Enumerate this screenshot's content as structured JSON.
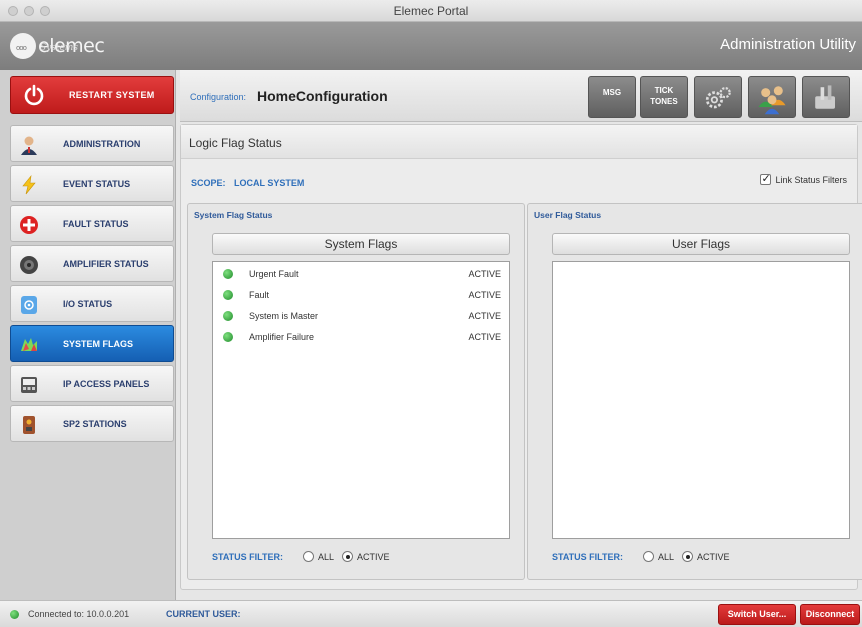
{
  "window": {
    "title": "Elemec Portal"
  },
  "brand": {
    "logo_text": "elemec",
    "logo_sub": "Systems",
    "app_title": "Administration Utility"
  },
  "sidebar": {
    "restart_label": "RESTART SYSTEM",
    "items": [
      {
        "label": "ADMINISTRATION",
        "icon": "person-icon",
        "active": false
      },
      {
        "label": "EVENT STATUS",
        "icon": "lightning-icon",
        "active": false
      },
      {
        "label": "FAULT STATUS",
        "icon": "plus-cross-icon",
        "active": false
      },
      {
        "label": "AMPLIFIER STATUS",
        "icon": "speaker-icon",
        "active": false
      },
      {
        "label": "I/O STATUS",
        "icon": "io-device-icon",
        "active": false
      },
      {
        "label": "SYSTEM FLAGS",
        "icon": "flags-icon",
        "active": true
      },
      {
        "label": "IP ACCESS PANELS",
        "icon": "panel-icon",
        "active": false
      },
      {
        "label": "SP2 STATIONS",
        "icon": "station-icon",
        "active": false
      }
    ]
  },
  "config": {
    "label": "Configuration:",
    "value": "HomeConfiguration",
    "toolbar": {
      "msg": "MSG",
      "tick_tones_1": "TICK",
      "tick_tones_2": "TONES"
    }
  },
  "content": {
    "heading": "Logic Flag Status",
    "scope_label": "SCOPE:",
    "scope_value": "LOCAL SYSTEM",
    "link_filters_label": "Link Status Filters",
    "link_filters_checked": true,
    "system_panel": {
      "title": "System Flag Status",
      "header": "System Flags",
      "rows": [
        {
          "name": "Urgent Fault",
          "status": "ACTIVE"
        },
        {
          "name": "Fault",
          "status": "ACTIVE"
        },
        {
          "name": "System is Master",
          "status": "ACTIVE"
        },
        {
          "name": "Amplifier Failure",
          "status": "ACTIVE"
        }
      ],
      "filter_label": "STATUS FILTER:",
      "opt_all": "ALL",
      "opt_active": "ACTIVE",
      "selected": "ACTIVE"
    },
    "user_panel": {
      "title": "User Flag Status",
      "header": "User Flags",
      "rows": [],
      "filter_label": "STATUS FILTER:",
      "opt_all": "ALL",
      "opt_active": "ACTIVE",
      "selected": "ACTIVE"
    }
  },
  "status": {
    "connected": "Connected to: 10.0.0.201",
    "current_user": "CURRENT USER:",
    "switch_user": "Switch User...",
    "disconnect": "Disconnect"
  },
  "colors": {
    "accent_blue": "#1b6fc7",
    "danger_red": "#cc2222",
    "ok_green": "#2aa33a"
  }
}
